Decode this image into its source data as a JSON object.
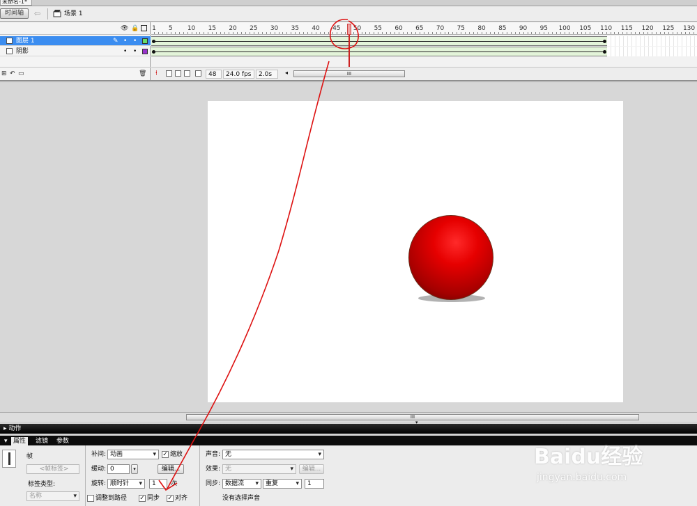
{
  "document": {
    "tab_title": "未命名-1*"
  },
  "edit_bar": {
    "timeline_button": "时间轴",
    "scene": "场景 1"
  },
  "timeline": {
    "ruler_ticks": [
      "1",
      "5",
      "10",
      "15",
      "20",
      "25",
      "30",
      "35",
      "40",
      "45",
      "50",
      "55",
      "60",
      "65",
      "70",
      "75",
      "80",
      "85",
      "90",
      "95",
      "100",
      "105",
      "110",
      "115",
      "120",
      "125",
      "130"
    ],
    "layers": [
      {
        "name": "图层 1",
        "selected": true,
        "color": "#66dd66"
      },
      {
        "name": "阴影",
        "selected": false,
        "color": "#9933cc"
      }
    ],
    "current_frame": 48,
    "frame_rate": "24.0 fps",
    "elapsed": "2.0s",
    "last_keyframe": 110,
    "scroll_handle": "III"
  },
  "stage": {
    "ball_color": "#e60000",
    "background": "#ffffff"
  },
  "workspace": {
    "scroll_handle": "III"
  },
  "panels": {
    "actions": "动作",
    "tabs": [
      "属性",
      "滤镜",
      "参数"
    ],
    "frame": {
      "title": "帧",
      "label_placeholder": "<帧标签>",
      "label_type_label": "标签类型:",
      "label_type_value": "名称"
    },
    "tween": {
      "tween_label": "补间:",
      "tween_value": "动画",
      "scale_label": "缩放",
      "scale_checked": true,
      "ease_label": "缓动:",
      "ease_value": "0",
      "edit_button": "编辑...",
      "rotate_label": "旋转:",
      "rotate_value": "顺时针",
      "rotate_times": "1",
      "times_unit": "次",
      "orient_label": "调整到路径",
      "orient_checked": false,
      "sync_label": "同步",
      "sync_checked": true,
      "snap_label": "对齐",
      "snap_checked": true
    },
    "sound": {
      "sound_label": "声音:",
      "sound_value": "无",
      "effect_label": "效果:",
      "effect_value": "无",
      "edit_button": "编辑...",
      "sync_label": "同步:",
      "sync_value": "数据流",
      "repeat_value": "重复",
      "repeat_count": "1",
      "status": "没有选择声音"
    }
  },
  "watermark": {
    "main": "Baidu经验",
    "sub": "jingyan.baidu.com"
  },
  "annotation_color": "#dd1111"
}
